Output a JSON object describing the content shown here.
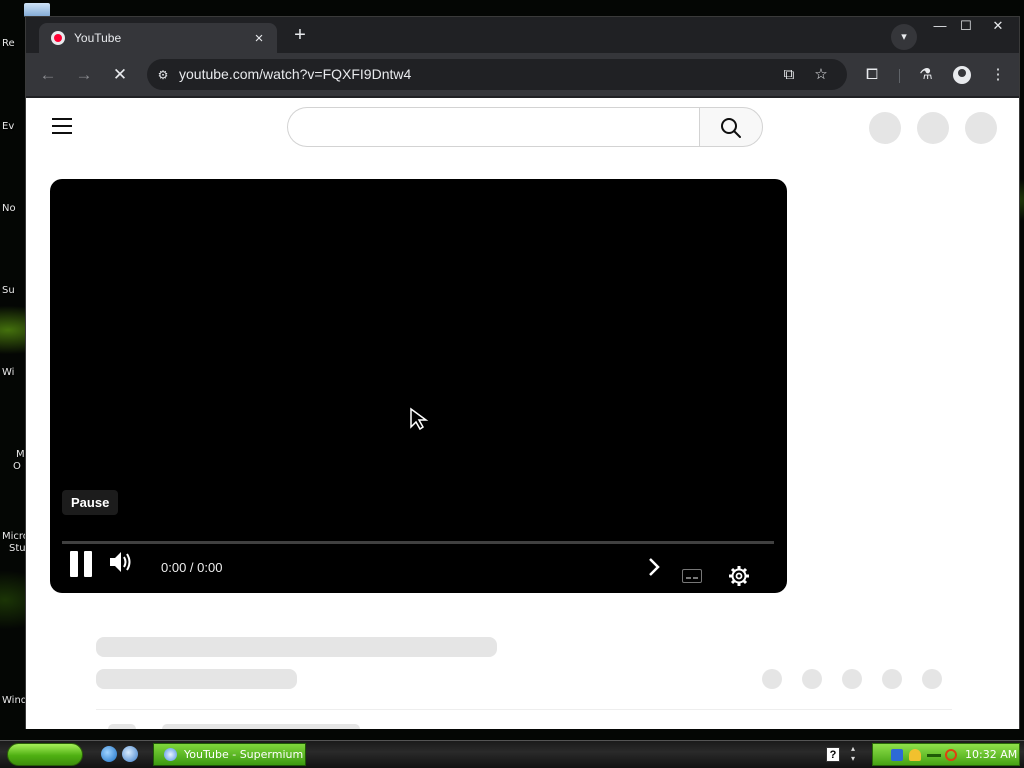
{
  "desktop": {
    "labels": [
      "Re",
      "Ev",
      "No",
      "Su",
      "Wi",
      "M",
      "O",
      "Micro",
      "Stu",
      "Wind"
    ]
  },
  "browser": {
    "tab": {
      "title": "YouTube",
      "close_icon": "×"
    },
    "new_tab_icon": "+",
    "tab_search_icon": "▾",
    "window_controls": {
      "minimize": "—",
      "maximize": "☐",
      "close": "✕"
    },
    "toolbar": {
      "back_icon": "←",
      "forward_icon": "→",
      "stop_icon": "✕",
      "site_info_icon": "⚙",
      "url": "youtube.com/watch?v=FQXFI9Dntw4",
      "install_icon": "⧉",
      "star_icon": "☆",
      "extensions_icon": "⧠",
      "labs_icon": "⚗",
      "menu_icon": "⋮"
    }
  },
  "youtube": {
    "search": {
      "value": "",
      "placeholder": ""
    },
    "player": {
      "tooltip": "Pause",
      "time": "0:00 / 0:00",
      "progress_fraction": 0
    }
  },
  "taskbar": {
    "task_button": "YouTube - Supermium",
    "help_icon": "?",
    "clock": "10:32 AM"
  },
  "colors": {
    "chrome_dark": "#202124",
    "chrome_toolbar": "#35363a",
    "youtube_red": "#ff0033",
    "xp_green": "#46a314"
  }
}
